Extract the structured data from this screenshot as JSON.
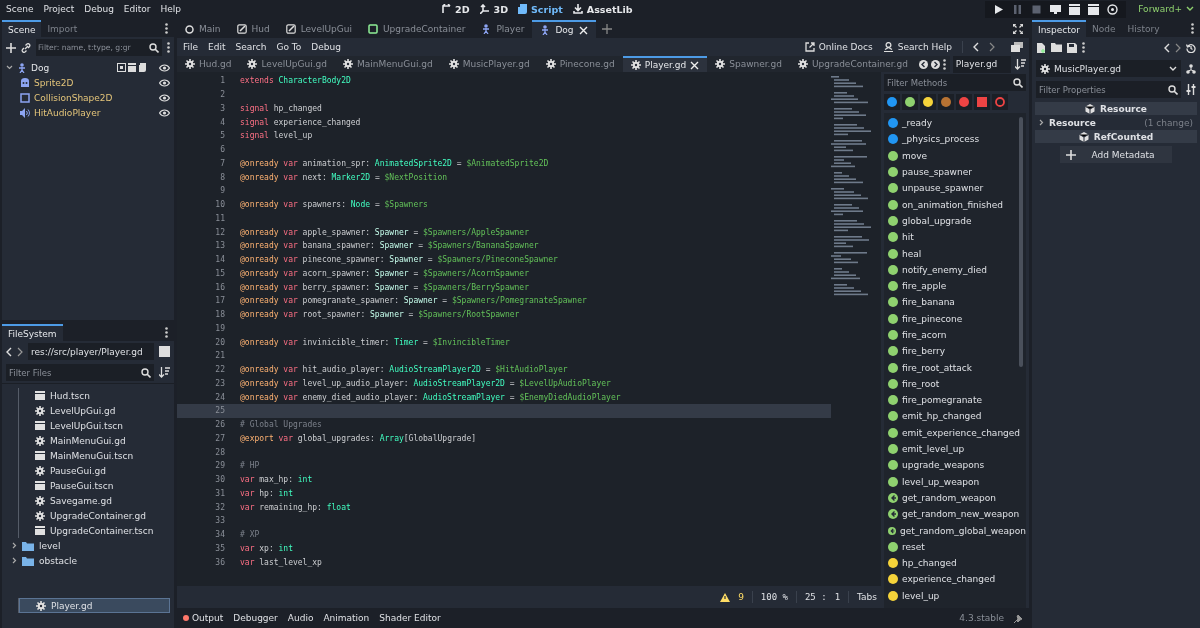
{
  "menu": [
    "Scene",
    "Project",
    "Debug",
    "Editor",
    "Help"
  ],
  "workspaces": [
    {
      "label": "2D",
      "selected": false
    },
    {
      "label": "3D",
      "selected": false
    },
    {
      "label": "Script",
      "selected": true
    },
    {
      "label": "AssetLib",
      "selected": false
    }
  ],
  "run_buttons": [
    {
      "kind": "play",
      "disabled": false
    },
    {
      "kind": "pause",
      "disabled": true
    },
    {
      "kind": "stop",
      "disabled": true
    },
    {
      "kind": "remote",
      "disabled": false
    },
    {
      "kind": "scene",
      "disabled": false
    },
    {
      "kind": "custom",
      "disabled": false
    },
    {
      "kind": "movie",
      "disabled": false
    }
  ],
  "renderer": "Forward+",
  "scene_dock": {
    "tabs": [
      {
        "label": "Scene",
        "selected": true
      },
      {
        "label": "Import",
        "selected": false
      }
    ],
    "filter": {
      "placeholder": "Filter: name, t:type, g:gr"
    },
    "root": {
      "name": "Dog",
      "children": [
        {
          "name": "Sprite2D"
        },
        {
          "name": "CollisionShape2D"
        },
        {
          "name": "HitAudioPlayer"
        }
      ]
    }
  },
  "filesystem": {
    "tab": "FileSystem",
    "path": "res://src/player/Player.gd",
    "filter": {
      "placeholder": "Filter Files"
    },
    "tree": [
      {
        "kind": "group",
        "children": [
          {
            "kind": "scene",
            "name": "Hud.tscn",
            "selected": false
          },
          {
            "kind": "script",
            "name": "LevelUpGui.gd",
            "selected": false
          },
          {
            "kind": "scene",
            "name": "LevelUpGui.tscn",
            "selected": false
          },
          {
            "kind": "script",
            "name": "MainMenuGui.gd",
            "selected": false
          },
          {
            "kind": "scene",
            "name": "MainMenuGui.tscn",
            "selected": false
          },
          {
            "kind": "script",
            "name": "PauseGui.gd",
            "selected": false
          },
          {
            "kind": "scene",
            "name": "PauseGui.tscn",
            "selected": false
          },
          {
            "kind": "script",
            "name": "Savegame.gd",
            "selected": false
          },
          {
            "kind": "script",
            "name": "UpgradeContainer.gd",
            "selected": false
          },
          {
            "kind": "scene",
            "name": "UpgradeContainer.tscn",
            "selected": false
          }
        ]
      },
      {
        "kind": "folder",
        "name": "level",
        "selected": false
      },
      {
        "kind": "folder",
        "name": "obstacle",
        "selected": false
      },
      {
        "kind": "group",
        "children": [
          {
            "kind": "script",
            "name": "Player.gd",
            "selected": true
          }
        ]
      }
    ]
  },
  "scene_tabs": [
    {
      "label": "Main",
      "selected": false
    },
    {
      "label": "Hud",
      "selected": false
    },
    {
      "label": "LevelUpGui",
      "selected": false
    },
    {
      "label": "UpgradeContainer",
      "selected": false
    },
    {
      "label": "Player",
      "selected": false
    },
    {
      "label": "Dog",
      "selected": true
    }
  ],
  "script_menu": [
    "File",
    "Edit",
    "Search",
    "Go To",
    "Debug"
  ],
  "help_buttons": [
    {
      "label": "Online Docs"
    },
    {
      "label": "Search Help"
    }
  ],
  "script_tabs": [
    {
      "label": "Hud.gd",
      "selected": false
    },
    {
      "label": "LevelUpGui.gd",
      "selected": false
    },
    {
      "label": "MainMenuGui.gd",
      "selected": false
    },
    {
      "label": "MusicPlayer.gd",
      "selected": false
    },
    {
      "label": "Pinecone.gd",
      "selected": false
    },
    {
      "label": "Player.gd",
      "selected": true
    },
    {
      "label": "Spawner.gd",
      "selected": false
    },
    {
      "label": "UpgradeContainer.gd",
      "selected": false
    }
  ],
  "code": [
    {
      "number": "1",
      "current": false,
      "tokens": [
        {
          "kind": "keyword",
          "text": "extends"
        },
        {
          "kind": "type",
          "text": " CharacterBody2D"
        }
      ]
    },
    {
      "number": "2",
      "current": false
    },
    {
      "number": "3",
      "current": false,
      "tokens": [
        {
          "kind": "keyword",
          "text": "signal"
        },
        {
          "kind": "text",
          "text": " hp_changed"
        }
      ]
    },
    {
      "number": "4",
      "current": false,
      "tokens": [
        {
          "kind": "keyword",
          "text": "signal"
        },
        {
          "kind": "text",
          "text": " experience_changed"
        }
      ]
    },
    {
      "number": "5",
      "current": false,
      "tokens": [
        {
          "kind": "keyword",
          "text": "signal"
        },
        {
          "kind": "text",
          "text": " level_up"
        }
      ]
    },
    {
      "number": "6",
      "current": false
    },
    {
      "number": "7",
      "current": false,
      "tokens": [
        {
          "kind": "annotation",
          "text": "@onready"
        },
        {
          "kind": "keyword",
          "text": " var"
        },
        {
          "kind": "text",
          "text": " animation_spr:"
        },
        {
          "kind": "type",
          "text": " AnimatedSprite2D"
        },
        {
          "kind": "text",
          "text": " ="
        },
        {
          "kind": "path",
          "text": " $AnimatedSprite2D"
        }
      ]
    },
    {
      "number": "8",
      "current": false,
      "tokens": [
        {
          "kind": "annotation",
          "text": "@onready"
        },
        {
          "kind": "keyword",
          "text": " var"
        },
        {
          "kind": "text",
          "text": " next:"
        },
        {
          "kind": "type",
          "text": " Marker2D"
        },
        {
          "kind": "text",
          "text": " ="
        },
        {
          "kind": "path",
          "text": " $NextPosition"
        }
      ]
    },
    {
      "number": "9",
      "current": false
    },
    {
      "number": "10",
      "current": false,
      "tokens": [
        {
          "kind": "annotation",
          "text": "@onready"
        },
        {
          "kind": "keyword",
          "text": " var"
        },
        {
          "kind": "text",
          "text": " spawners:"
        },
        {
          "kind": "type",
          "text": " Node"
        },
        {
          "kind": "text",
          "text": " ="
        },
        {
          "kind": "path",
          "text": " $Spawners"
        }
      ]
    },
    {
      "number": "11",
      "current": false
    },
    {
      "number": "12",
      "current": false,
      "tokens": [
        {
          "kind": "annotation",
          "text": "@onready"
        },
        {
          "kind": "keyword",
          "text": " var"
        },
        {
          "kind": "text",
          "text": " apple_spawner:"
        },
        {
          "kind": "usertype",
          "text": " Spawner"
        },
        {
          "kind": "text",
          "text": " ="
        },
        {
          "kind": "path",
          "text": " $Spawners/AppleSpawner"
        }
      ]
    },
    {
      "number": "13",
      "current": false,
      "tokens": [
        {
          "kind": "annotation",
          "text": "@onready"
        },
        {
          "kind": "keyword",
          "text": " var"
        },
        {
          "kind": "text",
          "text": " banana_spawner:"
        },
        {
          "kind": "usertype",
          "text": " Spawner"
        },
        {
          "kind": "text",
          "text": " ="
        },
        {
          "kind": "path",
          "text": " $Spawners/BananaSpawner"
        }
      ]
    },
    {
      "number": "14",
      "current": false,
      "tokens": [
        {
          "kind": "annotation",
          "text": "@onready"
        },
        {
          "kind": "keyword",
          "text": " var"
        },
        {
          "kind": "text",
          "text": " pinecone_spawner:"
        },
        {
          "kind": "usertype",
          "text": " Spawner"
        },
        {
          "kind": "text",
          "text": " ="
        },
        {
          "kind": "path",
          "text": " $Spawners/PineconeSpawner"
        }
      ]
    },
    {
      "number": "15",
      "current": false,
      "tokens": [
        {
          "kind": "annotation",
          "text": "@onready"
        },
        {
          "kind": "keyword",
          "text": " var"
        },
        {
          "kind": "text",
          "text": " acorn_spawner:"
        },
        {
          "kind": "usertype",
          "text": " Spawner"
        },
        {
          "kind": "text",
          "text": " ="
        },
        {
          "kind": "path",
          "text": " $Spawners/AcornSpawner"
        }
      ]
    },
    {
      "number": "16",
      "current": false,
      "tokens": [
        {
          "kind": "annotation",
          "text": "@onready"
        },
        {
          "kind": "keyword",
          "text": " var"
        },
        {
          "kind": "text",
          "text": " berry_spawner:"
        },
        {
          "kind": "usertype",
          "text": " Spawner"
        },
        {
          "kind": "text",
          "text": " ="
        },
        {
          "kind": "path",
          "text": " $Spawners/BerrySpawner"
        }
      ]
    },
    {
      "number": "17",
      "current": false,
      "tokens": [
        {
          "kind": "annotation",
          "text": "@onready"
        },
        {
          "kind": "keyword",
          "text": " var"
        },
        {
          "kind": "text",
          "text": " pomegranate_spawner:"
        },
        {
          "kind": "usertype",
          "text": " Spawner"
        },
        {
          "kind": "text",
          "text": " ="
        },
        {
          "kind": "path",
          "text": " $Spawners/PomegranateSpawner"
        }
      ]
    },
    {
      "number": "18",
      "current": false,
      "tokens": [
        {
          "kind": "annotation",
          "text": "@onready"
        },
        {
          "kind": "keyword",
          "text": " var"
        },
        {
          "kind": "text",
          "text": " root_spawner:"
        },
        {
          "kind": "usertype",
          "text": " Spawner"
        },
        {
          "kind": "text",
          "text": " ="
        },
        {
          "kind": "path",
          "text": " $Spawners/RootSpawner"
        }
      ]
    },
    {
      "number": "19",
      "current": false
    },
    {
      "number": "20",
      "current": false,
      "tokens": [
        {
          "kind": "annotation",
          "text": "@onready"
        },
        {
          "kind": "keyword",
          "text": " var"
        },
        {
          "kind": "text",
          "text": " invinicible_timer:"
        },
        {
          "kind": "type",
          "text": " Timer"
        },
        {
          "kind": "text",
          "text": " ="
        },
        {
          "kind": "path",
          "text": " $InvincibleTimer"
        }
      ]
    },
    {
      "number": "21",
      "current": false
    },
    {
      "number": "22",
      "current": false,
      "tokens": [
        {
          "kind": "annotation",
          "text": "@onready"
        },
        {
          "kind": "keyword",
          "text": " var"
        },
        {
          "kind": "text",
          "text": " hit_audio_player:"
        },
        {
          "kind": "type",
          "text": " AudioStreamPlayer2D"
        },
        {
          "kind": "text",
          "text": " ="
        },
        {
          "kind": "path",
          "text": " $HitAudioPlayer"
        }
      ]
    },
    {
      "number": "23",
      "current": false,
      "tokens": [
        {
          "kind": "annotation",
          "text": "@onready"
        },
        {
          "kind": "keyword",
          "text": " var"
        },
        {
          "kind": "text",
          "text": " level_up_audio_player:"
        },
        {
          "kind": "type",
          "text": " AudioStreamPlayer2D"
        },
        {
          "kind": "text",
          "text": " ="
        },
        {
          "kind": "path",
          "text": " $LevelUpAudioPlayer"
        }
      ]
    },
    {
      "number": "24",
      "current": false,
      "tokens": [
        {
          "kind": "annotation",
          "text": "@onready"
        },
        {
          "kind": "keyword",
          "text": " var"
        },
        {
          "kind": "text",
          "text": " enemy_died_audio_player:"
        },
        {
          "kind": "type",
          "text": " AudioStreamPlayer"
        },
        {
          "kind": "text",
          "text": " ="
        },
        {
          "kind": "path",
          "text": " $EnemyDiedAudioPlayer"
        }
      ]
    },
    {
      "number": "25",
      "current": true
    },
    {
      "number": "26",
      "current": false,
      "tokens": [
        {
          "kind": "comment",
          "text": "# Global Upgrades"
        }
      ]
    },
    {
      "number": "27",
      "current": false,
      "tokens": [
        {
          "kind": "annotation",
          "text": "@export"
        },
        {
          "kind": "keyword",
          "text": " var"
        },
        {
          "kind": "text",
          "text": " global_upgrades:"
        },
        {
          "kind": "type",
          "text": " Array"
        },
        {
          "kind": "text",
          "text": "[GlobalUpgrade]"
        }
      ]
    },
    {
      "number": "28",
      "current": false
    },
    {
      "number": "29",
      "current": false,
      "tokens": [
        {
          "kind": "comment",
          "text": "# HP"
        }
      ]
    },
    {
      "number": "30",
      "current": false,
      "tokens": [
        {
          "kind": "keyword",
          "text": "var"
        },
        {
          "kind": "text",
          "text": " max_hp:"
        },
        {
          "kind": "type",
          "text": " int"
        }
      ]
    },
    {
      "number": "31",
      "current": false,
      "tokens": [
        {
          "kind": "keyword",
          "text": "var"
        },
        {
          "kind": "text",
          "text": " hp:"
        },
        {
          "kind": "type",
          "text": " int"
        }
      ]
    },
    {
      "number": "32",
      "current": false,
      "tokens": [
        {
          "kind": "keyword",
          "text": "var"
        },
        {
          "kind": "text",
          "text": " remaining_hp:"
        },
        {
          "kind": "type",
          "text": " float"
        }
      ]
    },
    {
      "number": "33",
      "current": false
    },
    {
      "number": "34",
      "current": false,
      "tokens": [
        {
          "kind": "comment",
          "text": "# XP"
        }
      ]
    },
    {
      "number": "35",
      "current": false,
      "tokens": [
        {
          "kind": "keyword",
          "text": "var"
        },
        {
          "kind": "text",
          "text": " xp:"
        },
        {
          "kind": "type",
          "text": " int"
        }
      ]
    },
    {
      "number": "36",
      "current": false,
      "tokens": [
        {
          "kind": "keyword",
          "text": "var"
        },
        {
          "kind": "text",
          "text": " last_level_xp"
        }
      ]
    }
  ],
  "status": {
    "warnings": "9",
    "zoom": "100 %",
    "line": "25 :",
    "column": "1",
    "indent": "Tabs"
  },
  "methods": {
    "script": "Player.gd",
    "filter": {
      "placeholder": "Filter Methods"
    },
    "chips": [
      {
        "kind": "dot",
        "color": "#2196f3"
      },
      {
        "kind": "dot",
        "color": "#8fd16f"
      },
      {
        "kind": "dot",
        "color": "#f5d33a"
      },
      {
        "kind": "dot",
        "color": "#b87333"
      },
      {
        "kind": "dot",
        "color": "#ee4444"
      },
      {
        "kind": "square",
        "color": "#ee4444"
      },
      {
        "kind": "ring",
        "color": "#ee4444"
      }
    ],
    "items": [
      {
        "name": "_ready",
        "kind": "dot",
        "color": "#2196f3"
      },
      {
        "name": "_physics_process",
        "kind": "dot",
        "color": "#2196f3"
      },
      {
        "name": "move",
        "kind": "dot",
        "color": "#8fd16f"
      },
      {
        "name": "pause_spawner",
        "kind": "dot",
        "color": "#8fd16f"
      },
      {
        "name": "unpause_spawner",
        "kind": "dot",
        "color": "#8fd16f"
      },
      {
        "name": "on_animation_finished",
        "kind": "dot",
        "color": "#8fd16f"
      },
      {
        "name": "global_upgrade",
        "kind": "dot",
        "color": "#8fd16f"
      },
      {
        "name": "hit",
        "kind": "dot",
        "color": "#8fd16f"
      },
      {
        "name": "heal",
        "kind": "dot",
        "color": "#8fd16f"
      },
      {
        "name": "notify_enemy_died",
        "kind": "dot",
        "color": "#8fd16f"
      },
      {
        "name": "fire_apple",
        "kind": "dot",
        "color": "#8fd16f"
      },
      {
        "name": "fire_banana",
        "kind": "dot",
        "color": "#8fd16f"
      },
      {
        "name": "fire_pinecone",
        "kind": "dot",
        "color": "#8fd16f"
      },
      {
        "name": "fire_acorn",
        "kind": "dot",
        "color": "#8fd16f"
      },
      {
        "name": "fire_berry",
        "kind": "dot",
        "color": "#8fd16f"
      },
      {
        "name": "fire_root_attack",
        "kind": "dot",
        "color": "#8fd16f"
      },
      {
        "name": "fire_root",
        "kind": "dot",
        "color": "#8fd16f"
      },
      {
        "name": "fire_pomegranate",
        "kind": "dot",
        "color": "#8fd16f"
      },
      {
        "name": "emit_hp_changed",
        "kind": "dot",
        "color": "#8fd16f"
      },
      {
        "name": "emit_experience_changed",
        "kind": "dot",
        "color": "#8fd16f"
      },
      {
        "name": "emit_level_up",
        "kind": "dot",
        "color": "#8fd16f"
      },
      {
        "name": "upgrade_weapons",
        "kind": "dot",
        "color": "#8fd16f"
      },
      {
        "name": "level_up_weapon",
        "kind": "dot",
        "color": "#8fd16f"
      },
      {
        "name": "get_random_weapon",
        "kind": "return",
        "color": "#8fd16f"
      },
      {
        "name": "get_random_new_weapon",
        "kind": "return",
        "color": "#8fd16f"
      },
      {
        "name": "get_random_global_weapon",
        "kind": "return",
        "color": "#8fd16f"
      },
      {
        "name": "reset",
        "kind": "dot",
        "color": "#8fd16f"
      },
      {
        "name": "hp_changed",
        "kind": "dot",
        "color": "#f5d33a"
      },
      {
        "name": "experience_changed",
        "kind": "dot",
        "color": "#f5d33a"
      },
      {
        "name": "level_up",
        "kind": "dot",
        "color": "#f5d33a"
      }
    ]
  },
  "bottom_tabs": [
    {
      "label": "Output",
      "alert": true
    },
    {
      "label": "Debugger",
      "alert": false
    },
    {
      "label": "Audio",
      "alert": false
    },
    {
      "label": "Animation",
      "alert": false
    },
    {
      "label": "Shader Editor",
      "alert": false
    }
  ],
  "version": "4.3.stable",
  "inspector": {
    "tabs": [
      {
        "label": "Inspector",
        "selected": true
      },
      {
        "label": "Node",
        "selected": false
      },
      {
        "label": "History",
        "selected": false
      }
    ],
    "object": "MusicPlayer.gd",
    "filter": {
      "placeholder": "Filter Properties"
    },
    "sections": [
      {
        "kind": "header",
        "label": "Resource"
      },
      {
        "kind": "group",
        "label": "Resource",
        "note": "(1 change)"
      },
      {
        "kind": "header",
        "label": "RefCounted"
      }
    ],
    "add_button": "Add Metadata"
  }
}
